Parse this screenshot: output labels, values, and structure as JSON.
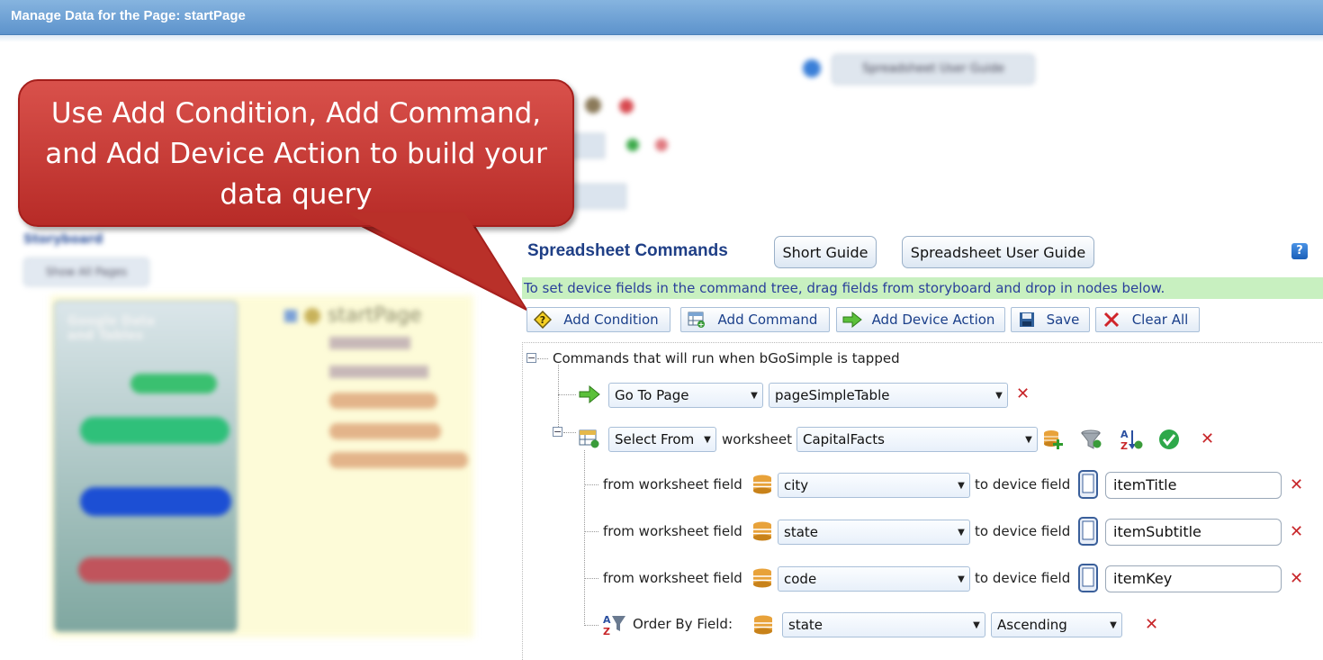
{
  "window": {
    "title": "Manage Data for the Page: startPage"
  },
  "callout": {
    "lines": [
      "Use Add Condition, Add Command,",
      "and Add Device Action to build your",
      "data query"
    ]
  },
  "blurred": {
    "top_button_label": "Spreadsheet User Guide",
    "storyboard_label": "Storyboard",
    "show_all_pages": "Show All Pages",
    "page_title": "Google Data and Tables",
    "tree_root": "startPage"
  },
  "commands_panel": {
    "title": "Spreadsheet Commands",
    "short_guide_label": "Short Guide",
    "user_guide_label": "Spreadsheet User Guide",
    "hint": "To set device fields in the command tree, drag fields from storyboard and drop in nodes below."
  },
  "toolbar": {
    "add_condition": "Add Condition",
    "add_command": "Add Command",
    "add_device_action": "Add Device Action",
    "save": "Save",
    "clear_all": "Clear All"
  },
  "tree": {
    "root_label": "Commands that will run when bGoSimple is tapped",
    "goto": {
      "action": "Go To Page",
      "target": "pageSimpleTable"
    },
    "select": {
      "mode": "Select From",
      "worksheet_label": "worksheet",
      "worksheet": "CapitalFacts"
    },
    "mappings": [
      {
        "from_label": "from worksheet field",
        "field": "city",
        "to_label": "to device field",
        "device_field": "itemTitle"
      },
      {
        "from_label": "from worksheet field",
        "field": "state",
        "to_label": "to device field",
        "device_field": "itemSubtitle"
      },
      {
        "from_label": "from worksheet field",
        "field": "code",
        "to_label": "to device field",
        "device_field": "itemKey"
      }
    ],
    "order": {
      "label": "Order By Field:",
      "field": "state",
      "direction": "Ascending"
    }
  },
  "colors": {
    "titlebar": "#5d93cc",
    "callout": "#c0332e",
    "hint_bg": "#c8f0c0",
    "delete_x": "#c8262a"
  }
}
